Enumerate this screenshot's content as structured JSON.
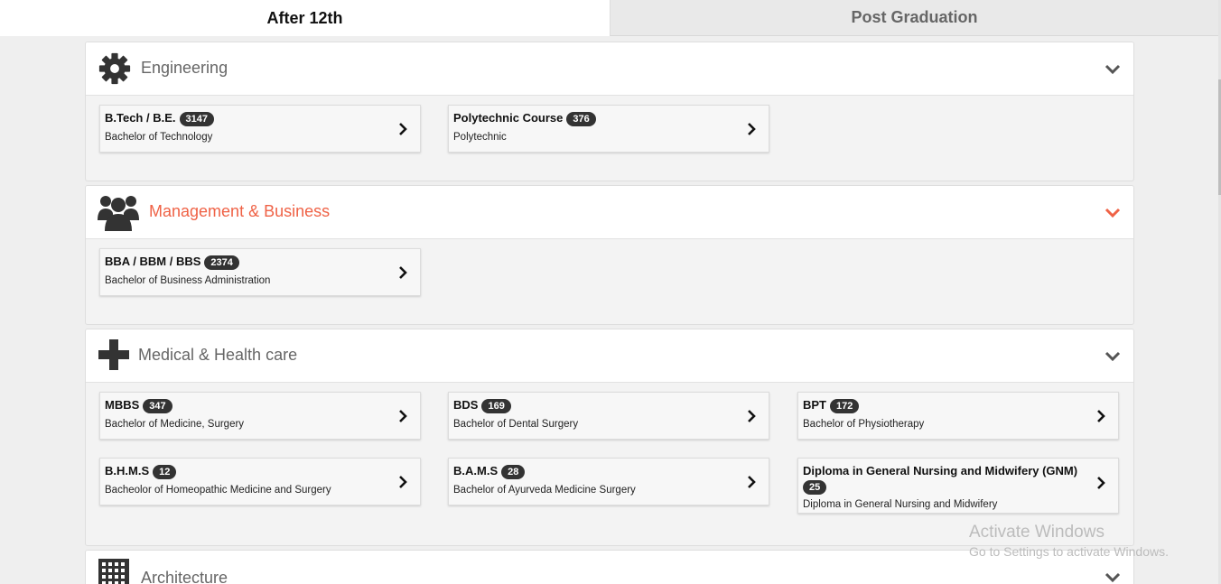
{
  "tabs": [
    {
      "label": "After 12th",
      "active": true
    },
    {
      "label": "Post Graduation",
      "active": false
    }
  ],
  "colors": {
    "accent": "#ef6246",
    "badge_bg": "#333333"
  },
  "sections": {
    "engineering": {
      "title": "Engineering",
      "icon": "gear-icon",
      "courses": [
        {
          "name": "B.Tech / B.E.",
          "count": "3147",
          "full": "Bachelor of Technology"
        },
        {
          "name": "Polytechnic Course",
          "count": "376",
          "full": "Polytechnic"
        }
      ]
    },
    "management": {
      "title": "Management & Business",
      "icon": "users-icon",
      "courses": [
        {
          "name": "BBA / BBM / BBS",
          "count": "2374",
          "full": "Bachelor of Business Administration"
        }
      ]
    },
    "medical": {
      "title": "Medical & Health care",
      "icon": "plus-icon",
      "courses": [
        {
          "name": "MBBS",
          "count": "347",
          "full": "Bachelor of Medicine, Surgery"
        },
        {
          "name": "BDS",
          "count": "169",
          "full": "Bachelor of Dental Surgery"
        },
        {
          "name": "BPT",
          "count": "172",
          "full": "Bachelor of Physiotherapy"
        },
        {
          "name": "B.H.M.S",
          "count": "12",
          "full": "Bacheolor of Homeopathic Medicine and Surgery"
        },
        {
          "name": "B.A.M.S",
          "count": "28",
          "full": "Bachelor of Ayurveda Medicine Surgery"
        },
        {
          "name": "Diploma in General Nursing and Midwifery (GNM)",
          "count": "25",
          "full": "Diploma in General Nursing and Midwifery"
        }
      ]
    },
    "architecture": {
      "title": "Architecture",
      "icon": "building-icon"
    }
  },
  "watermark": {
    "line1": "Activate Windows",
    "line2": "Go to Settings to activate Windows."
  }
}
